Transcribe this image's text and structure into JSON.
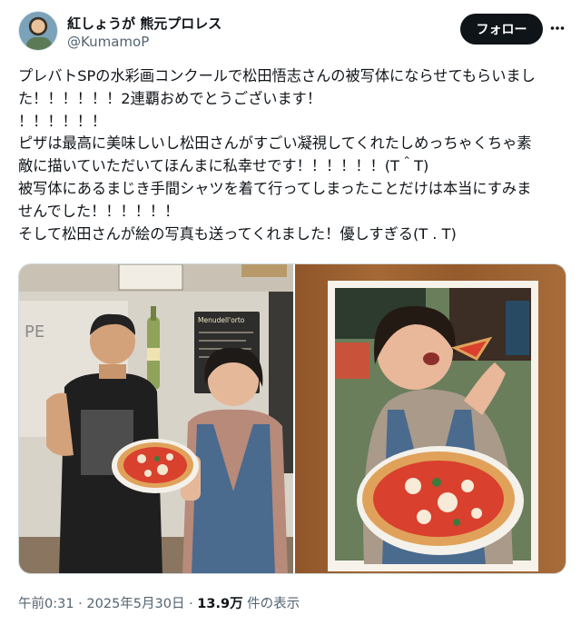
{
  "author": {
    "display_name": "紅しょうが 熊元プロレス",
    "handle": "@KumamoP",
    "avatar_icon": "avatar-photo"
  },
  "actions": {
    "follow_label": "フォロー",
    "more_icon": "more-dots-icon"
  },
  "tweet": {
    "lines": [
      "プレバトSPの水彩画コンクールで松田悟志さんの被写体にならせてもらいまし",
      "た！！！！！！2連覇おめでとうございます！",
      "！！！！！！",
      "ピザは最高に美味しいし松田さんがすごい凝視してくれたしめっちゃくちゃ素",
      "敵に描いていただいてほんまに私幸せです！！！！！！(T＾T)",
      "被写体にあるまじき手間シャツを着て行ってしまったことだけは本当にすみま",
      "せんでした！！！！！！",
      "そして松田さんが絵の写真も送ってくれました！優しすぎる(T . T)"
    ]
  },
  "media": {
    "photo_left": {
      "alt_icon": "photo-two-people-with-pizza",
      "sign_text": "Menudell'orto"
    },
    "photo_right": {
      "alt_icon": "watercolor-painting-woman-eating-pizza"
    },
    "colors": {
      "wood": "#9b5f2e",
      "pizza": "#d9402e",
      "crust": "#e0a25a",
      "denim": "#4a6a8e"
    }
  },
  "meta": {
    "time": "午前0:31",
    "separator": " · ",
    "date": "2025年5月30日",
    "views": "13.9万",
    "views_suffix": " 件の表示"
  },
  "colors": {
    "text": "#0f1419",
    "secondary": "#536471",
    "follow_bg": "#0f1419",
    "border": "#cfd9de"
  }
}
